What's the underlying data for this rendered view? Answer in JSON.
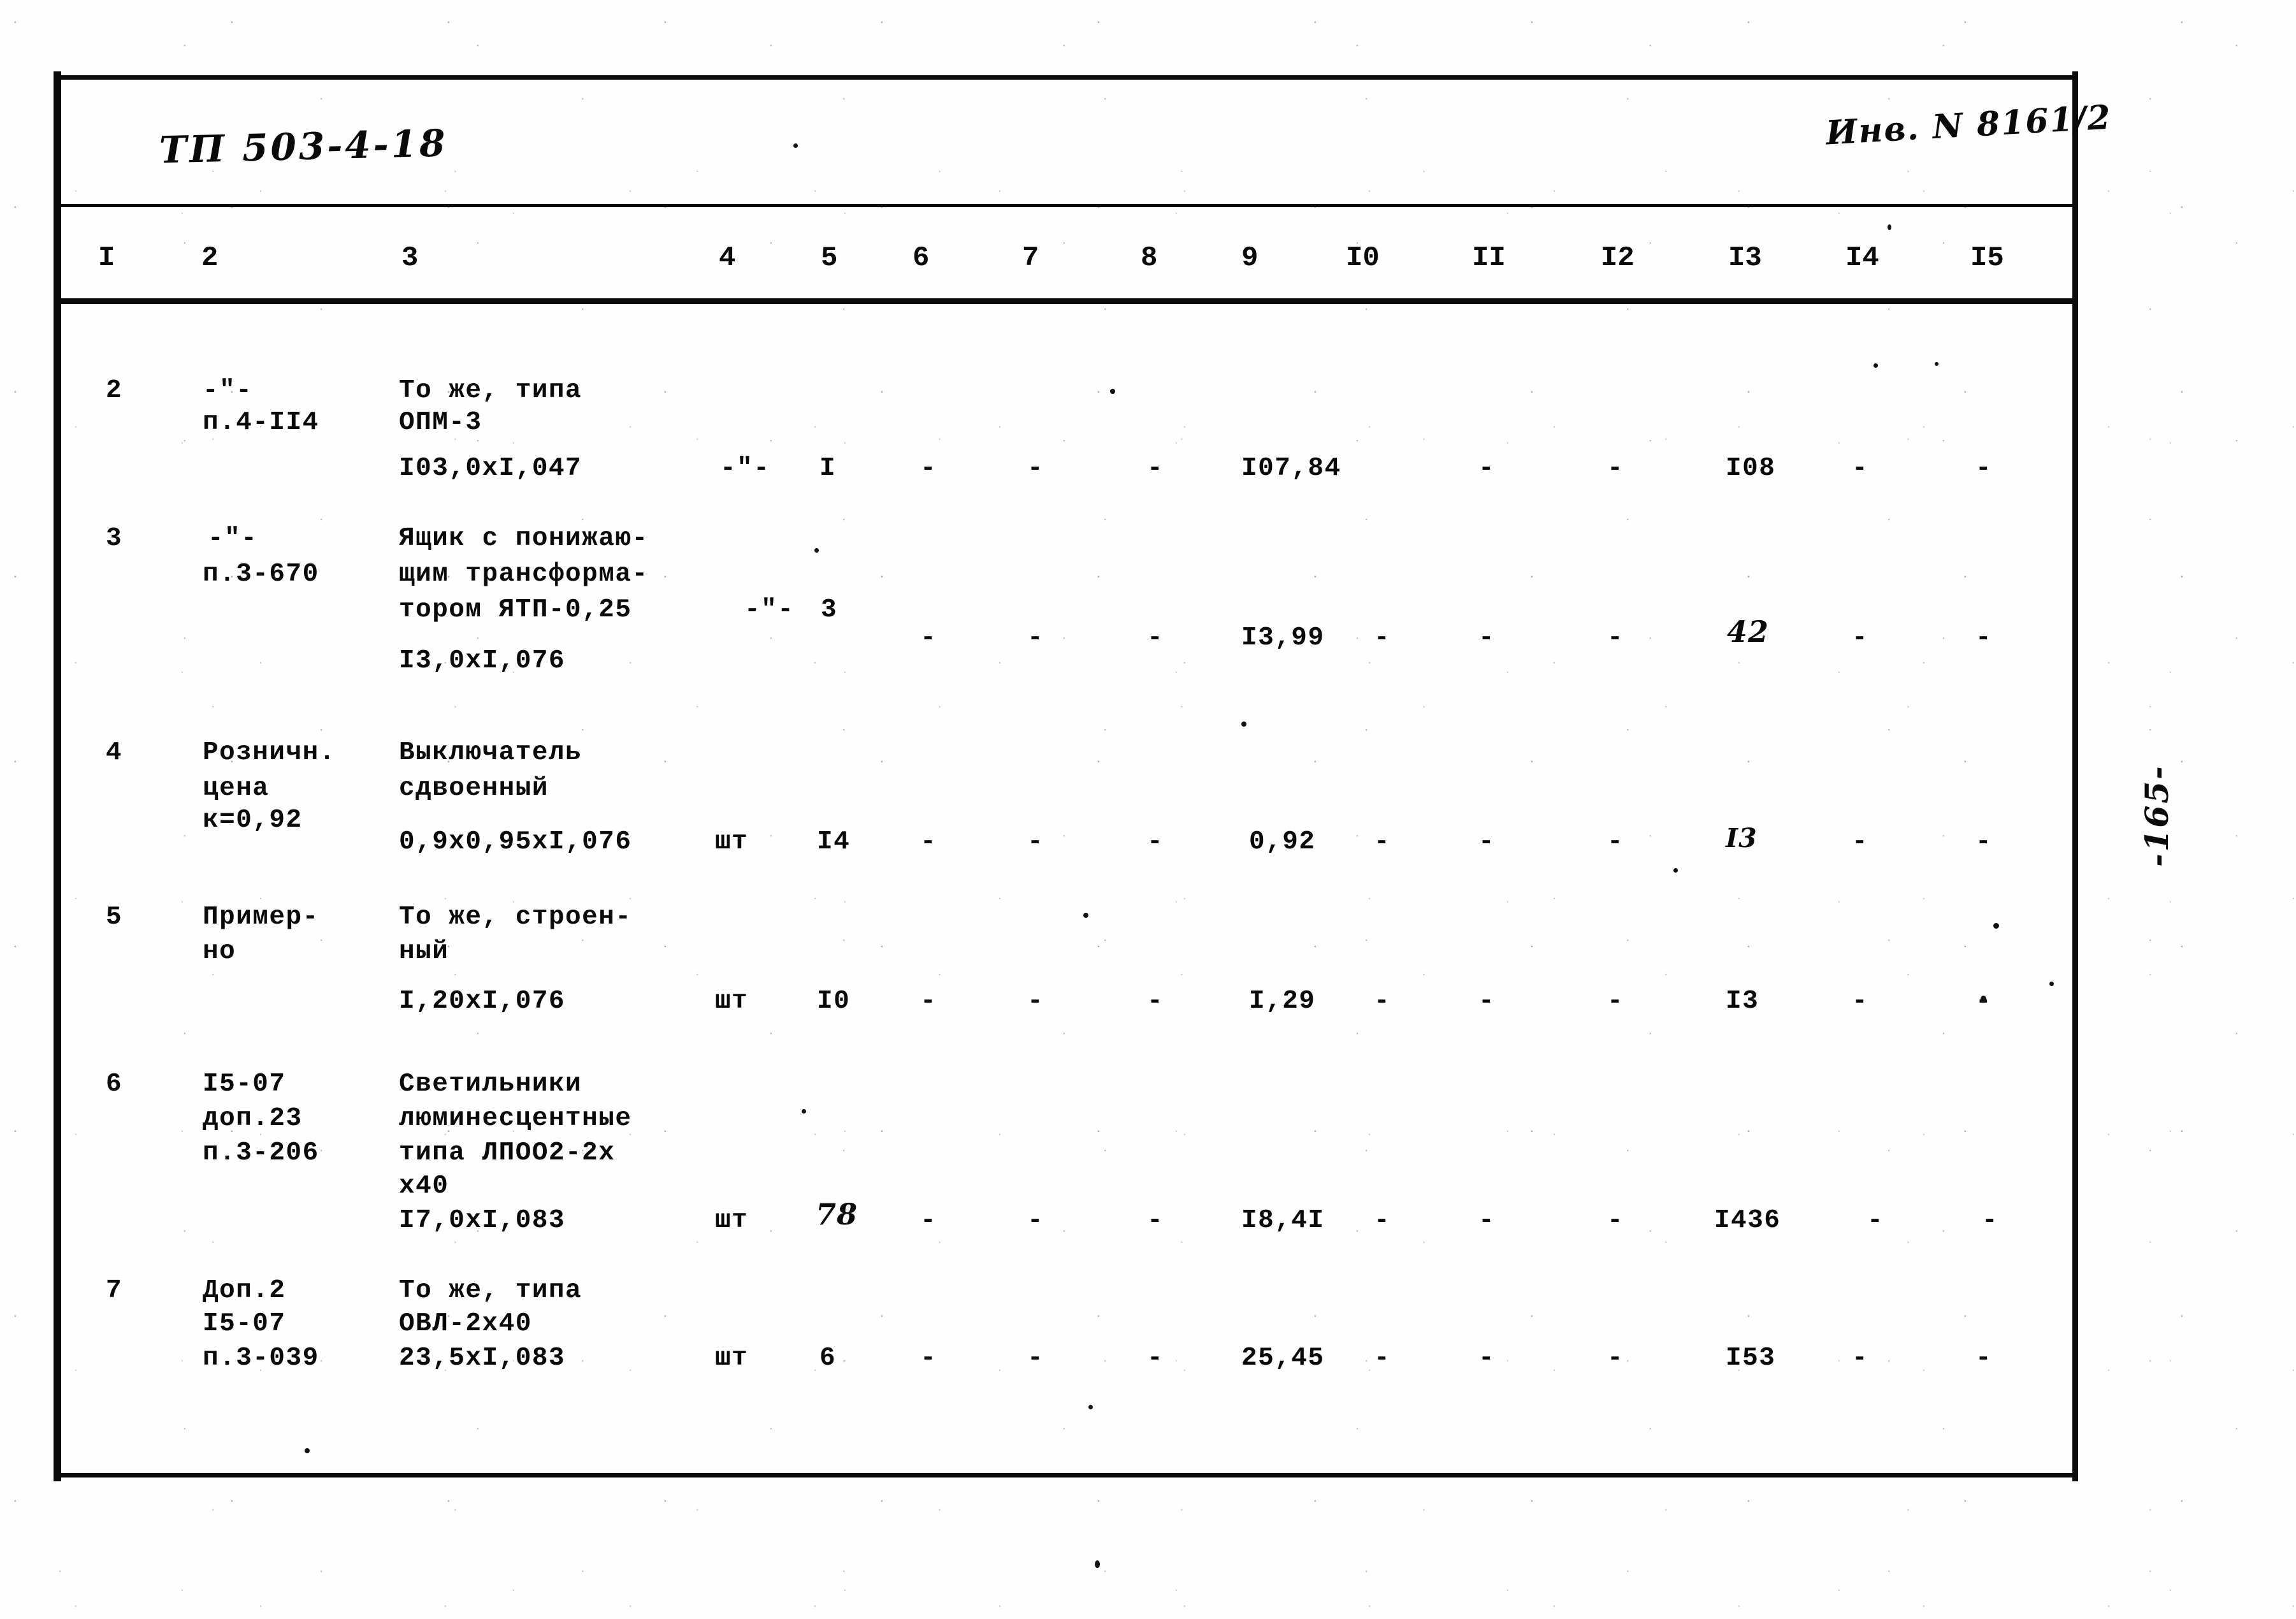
{
  "document": {
    "code_label": "ТП 503-4-18",
    "inventory_label": "Инв. N 8161/2",
    "page_number": "-165-"
  },
  "table": {
    "column_numbers": [
      "I",
      "2",
      "3",
      "4",
      "5",
      "6",
      "7",
      "8",
      "9",
      "I0",
      "II",
      "I2",
      "I3",
      "I4",
      "I5"
    ],
    "rows": [
      {
        "num": "2",
        "col2": [
          "-\"-",
          "п.4-II4"
        ],
        "col3": [
          "То же, типа",
          "ОПМ-3",
          "I03,0xI,047"
        ],
        "unit": "-\"-",
        "qty": "I",
        "c6": "-",
        "c7": "-",
        "c8": "-",
        "c9": "I07,84",
        "c10": "-",
        "c11": "-",
        "c12": "-",
        "c13": "I08",
        "c14": "-",
        "c15": "-"
      },
      {
        "num": "3",
        "col2": [
          "-\"-",
          "п.3-670"
        ],
        "col3": [
          "Ящик с понижаю-",
          "щим трансформа-",
          "тором ЯТП-0,25",
          "I3,0xI,076"
        ],
        "unit": "-\"-",
        "qty": "3",
        "c6": "-",
        "c7": "-",
        "c8": "-",
        "c9": "I3,99",
        "c9b": "-",
        "c10": "-",
        "c11": "-",
        "c12": "-",
        "c13": "42",
        "c14": "-",
        "c15": "-"
      },
      {
        "num": "4",
        "col2": [
          "Розничн.",
          "цена",
          "к=0,92"
        ],
        "col3": [
          "Выключатель",
          "сдвоенный",
          "0,9х0,95хI,076"
        ],
        "unit": "шт",
        "qty": "I4",
        "c6": "-",
        "c7": "-",
        "c8": "-",
        "c9": "0,92",
        "c9b": "-",
        "c10": "-",
        "c11": "-",
        "c12": "-",
        "c13": "I3",
        "c14": "-",
        "c15": "-"
      },
      {
        "num": "5",
        "col2": [
          "Пример-",
          "но"
        ],
        "col3": [
          "То же, строен-",
          "ный",
          "I,20хI,076"
        ],
        "unit": "шт",
        "qty": "I0",
        "c6": "-",
        "c7": "-",
        "c8": "-",
        "c9": "I,29",
        "c9b": "-",
        "c10": "-",
        "c11": "-",
        "c12": "-",
        "c13": "I3",
        "c14": "-",
        "c15": "-"
      },
      {
        "num": "6",
        "col2": [
          "I5-07",
          "доп.23",
          "п.3-206"
        ],
        "col3": [
          "Светильники",
          "люминесцентные",
          "типа ЛПОО2-2х",
          "х40",
          "I7,0хI,083"
        ],
        "unit": "шт",
        "qty": "78",
        "c6": "-",
        "c7": "-",
        "c8": "-",
        "c9": "I8,4I",
        "c9b": "-",
        "c10": "-",
        "c11": "-",
        "c12": "-",
        "c13": "I436",
        "c14": "-",
        "c15": "-"
      },
      {
        "num": "7",
        "col2": [
          "Доп.2",
          "I5-07",
          "п.3-039"
        ],
        "col3": [
          "То же, типа",
          "ОВЛ-2х40",
          "23,5хI,083"
        ],
        "unit": "шт",
        "qty": "6",
        "c6": "-",
        "c7": "-",
        "c8": "-",
        "c9": "25,45",
        "c9b": "-",
        "c10": "-",
        "c11": "-",
        "c12": "-",
        "c13": "I53",
        "c14": "-",
        "c15": "-"
      }
    ]
  }
}
